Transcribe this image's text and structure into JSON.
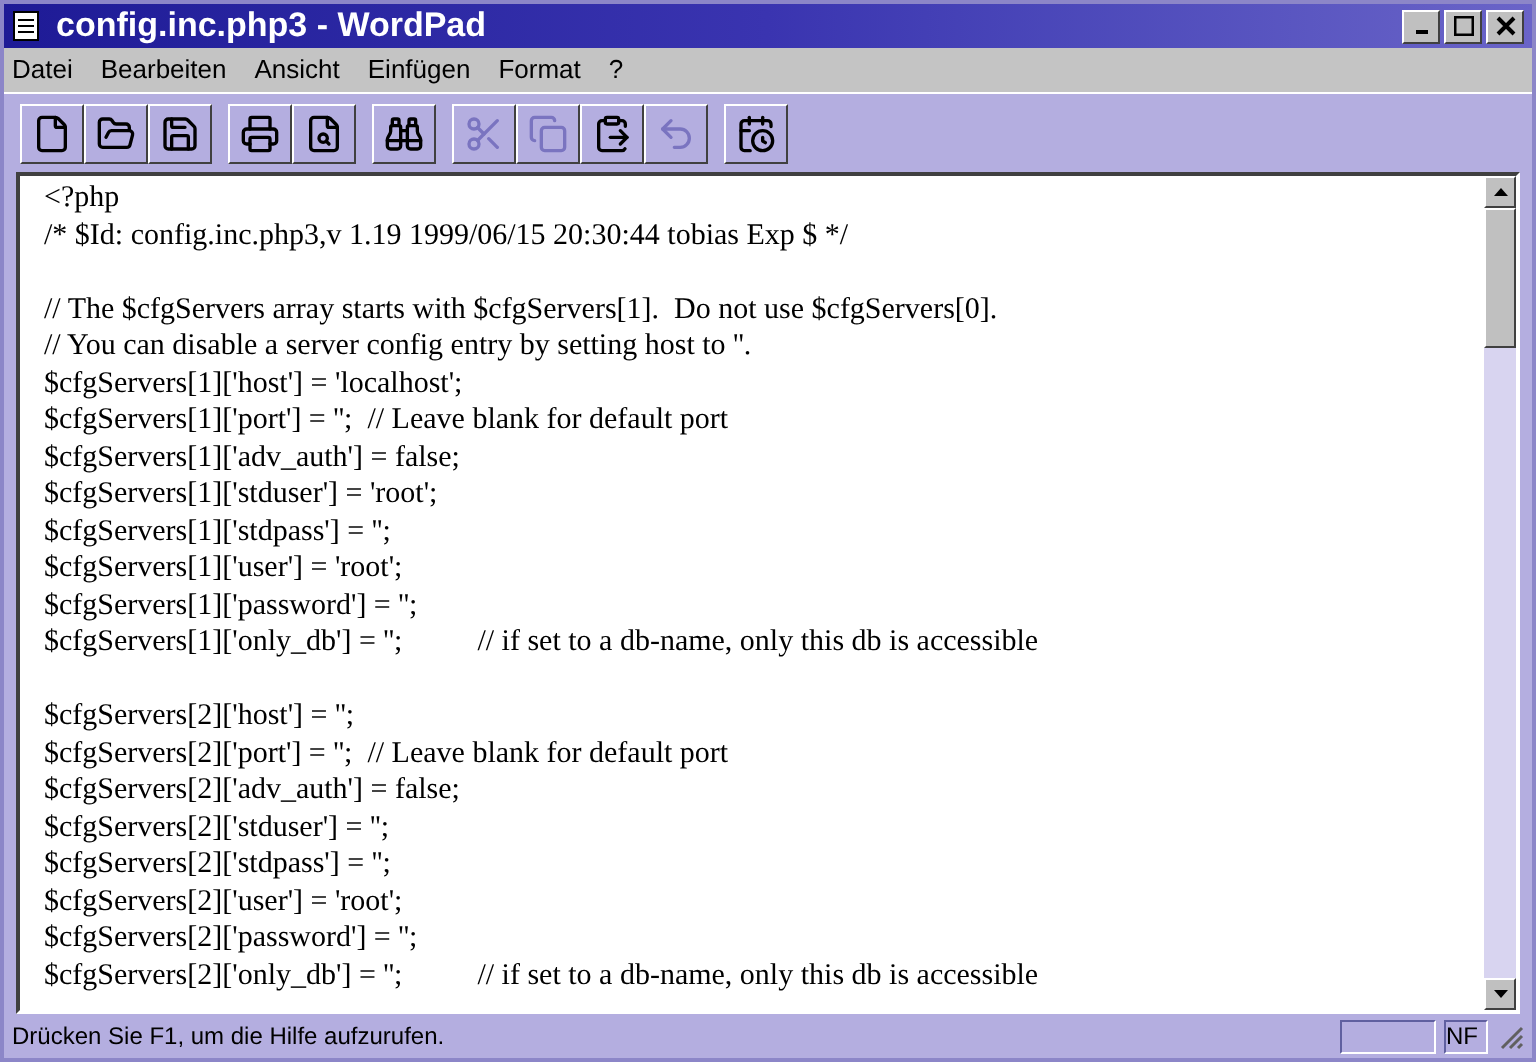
{
  "window": {
    "title": "config.inc.php3 - WordPad"
  },
  "menu": [
    "Datei",
    "Bearbeiten",
    "Ansicht",
    "Einfügen",
    "Format",
    "?"
  ],
  "toolbar": [
    [
      {
        "kind": "new",
        "disabled": false
      },
      {
        "kind": "open",
        "disabled": false
      },
      {
        "kind": "save",
        "disabled": false
      }
    ],
    [
      {
        "kind": "print",
        "disabled": false
      },
      {
        "kind": "preview",
        "disabled": false
      }
    ],
    [
      {
        "kind": "find",
        "disabled": false
      }
    ],
    [
      {
        "kind": "cut",
        "disabled": true
      },
      {
        "kind": "copy",
        "disabled": true
      },
      {
        "kind": "paste",
        "disabled": false
      },
      {
        "kind": "undo",
        "disabled": true
      }
    ],
    [
      {
        "kind": "date",
        "disabled": false
      }
    ]
  ],
  "document": {
    "paragraphs": [
      [
        "<?php",
        "/* $Id: config.inc.php3,v 1.19 1999/06/15 20:30:44 tobias Exp $ */"
      ],
      [
        "// The $cfgServers array starts with $cfgServers[1].  Do not use $cfgServers[0].",
        "// You can disable a server config entry by setting host to ''.",
        "$cfgServers[1]['host'] = 'localhost';",
        "$cfgServers[1]['port'] = '';  // Leave blank for default port",
        "$cfgServers[1]['adv_auth'] = false;",
        "$cfgServers[1]['stduser'] = 'root';",
        "$cfgServers[1]['stdpass'] = '';",
        "$cfgServers[1]['user'] = 'root';",
        "$cfgServers[1]['password'] = '';",
        "$cfgServers[1]['only_db'] = '';          // if set to a db-name, only this db is accessible"
      ],
      [
        "$cfgServers[2]['host'] = '';",
        "$cfgServers[2]['port'] = '';  // Leave blank for default port",
        "$cfgServers[2]['adv_auth'] = false;",
        "$cfgServers[2]['stduser'] = '';",
        "$cfgServers[2]['stdpass'] = '';",
        "$cfgServers[2]['user'] = 'root';",
        "$cfgServers[2]['password'] = '';",
        "$cfgServers[2]['only_db'] = '';          // if set to a db-name, only this db is accessible"
      ]
    ]
  },
  "status_bar": {
    "message": "Drücken Sie F1, um die Hilfe aufzurufen.",
    "indicator": "NF"
  }
}
